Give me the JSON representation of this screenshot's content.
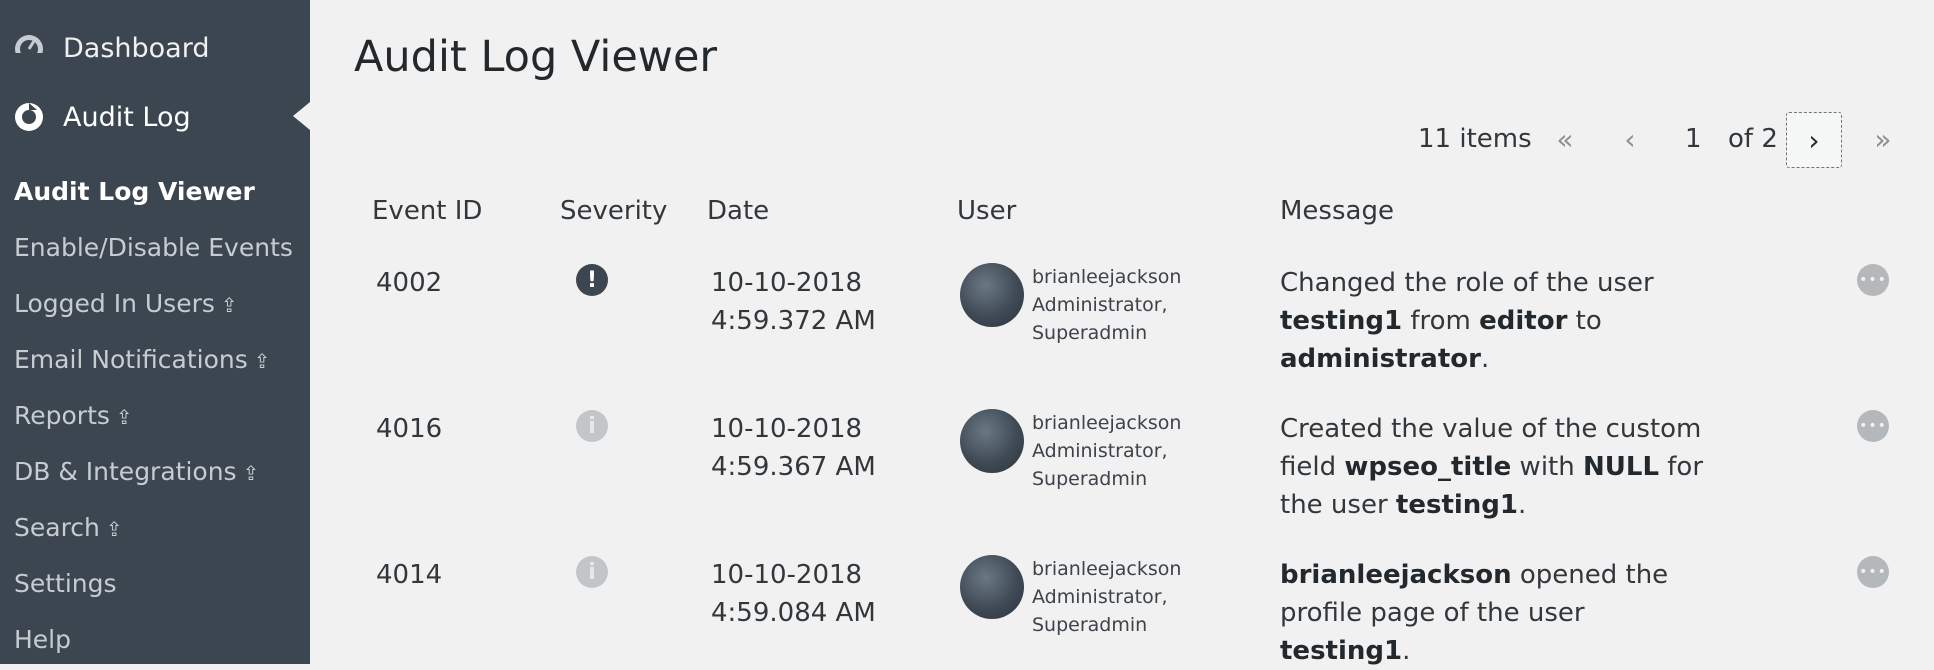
{
  "sidebar": {
    "top_items": [
      {
        "label": "Dashboard",
        "icon": "dashboard-icon"
      },
      {
        "label": "Audit Log",
        "icon": "audit-log-icon"
      }
    ],
    "sub_items": [
      {
        "label": "Audit Log Viewer",
        "current": true,
        "upgrade": false
      },
      {
        "label": "Enable/Disable Events",
        "upgrade": false
      },
      {
        "label": "Logged In Users",
        "upgrade": true
      },
      {
        "label": "Email Notifications",
        "upgrade": true
      },
      {
        "label": "Reports",
        "upgrade": true
      },
      {
        "label": "DB & Integrations",
        "upgrade": true
      },
      {
        "label": "Search",
        "upgrade": true
      },
      {
        "label": "Settings",
        "upgrade": false
      },
      {
        "label": "Help",
        "upgrade": false
      }
    ],
    "upgrade_glyph": "⇪",
    "colors": {
      "background": "#3c4650",
      "text": "#c7ccd1",
      "current": "#ffffff"
    }
  },
  "page": {
    "title": "Audit Log Viewer"
  },
  "pagination": {
    "count": "11 items",
    "first": "«",
    "prev": "‹",
    "current_page": "1",
    "of_total": "of 2",
    "next": "›",
    "last": "»"
  },
  "table": {
    "headers": {
      "event_id": "Event ID",
      "severity": "Severity",
      "date": "Date",
      "user": "User",
      "message": "Message"
    },
    "rows": [
      {
        "event_id": "4002",
        "severity": "critical",
        "severity_glyph": "!",
        "date_line1": "10-10-2018",
        "date_line2": "4:59.372 AM",
        "user_name": "brianleejackson",
        "user_role1": "Administrator,",
        "user_role2": "Superadmin",
        "message": [
          {
            "t": "Changed the role of the user "
          },
          {
            "t": "testing1",
            "b": true
          },
          {
            "t": " from "
          },
          {
            "t": "editor",
            "b": true
          },
          {
            "t": " to "
          },
          {
            "t": "administrator",
            "b": true
          },
          {
            "t": "."
          }
        ]
      },
      {
        "event_id": "4016",
        "severity": "info",
        "severity_glyph": "i",
        "date_line1": "10-10-2018",
        "date_line2": "4:59.367 AM",
        "user_name": "brianleejackson",
        "user_role1": "Administrator,",
        "user_role2": "Superadmin",
        "message": [
          {
            "t": "Created the value of the custom field "
          },
          {
            "t": "wpseo_title",
            "b": true
          },
          {
            "t": " with "
          },
          {
            "t": "NULL",
            "b": true
          },
          {
            "t": " for the user "
          },
          {
            "t": "testing1",
            "b": true
          },
          {
            "t": "."
          }
        ]
      },
      {
        "event_id": "4014",
        "severity": "info",
        "severity_glyph": "i",
        "date_line1": "10-10-2018",
        "date_line2": "4:59.084 AM",
        "user_name": "brianleejackson",
        "user_role1": "Administrator,",
        "user_role2": "Superadmin",
        "message": [
          {
            "t": "brianleejackson",
            "b": true
          },
          {
            "t": " opened the profile page of the user "
          },
          {
            "t": "testing1",
            "b": true
          },
          {
            "t": "."
          }
        ]
      }
    ],
    "row_action_icon": "more-options-icon"
  }
}
